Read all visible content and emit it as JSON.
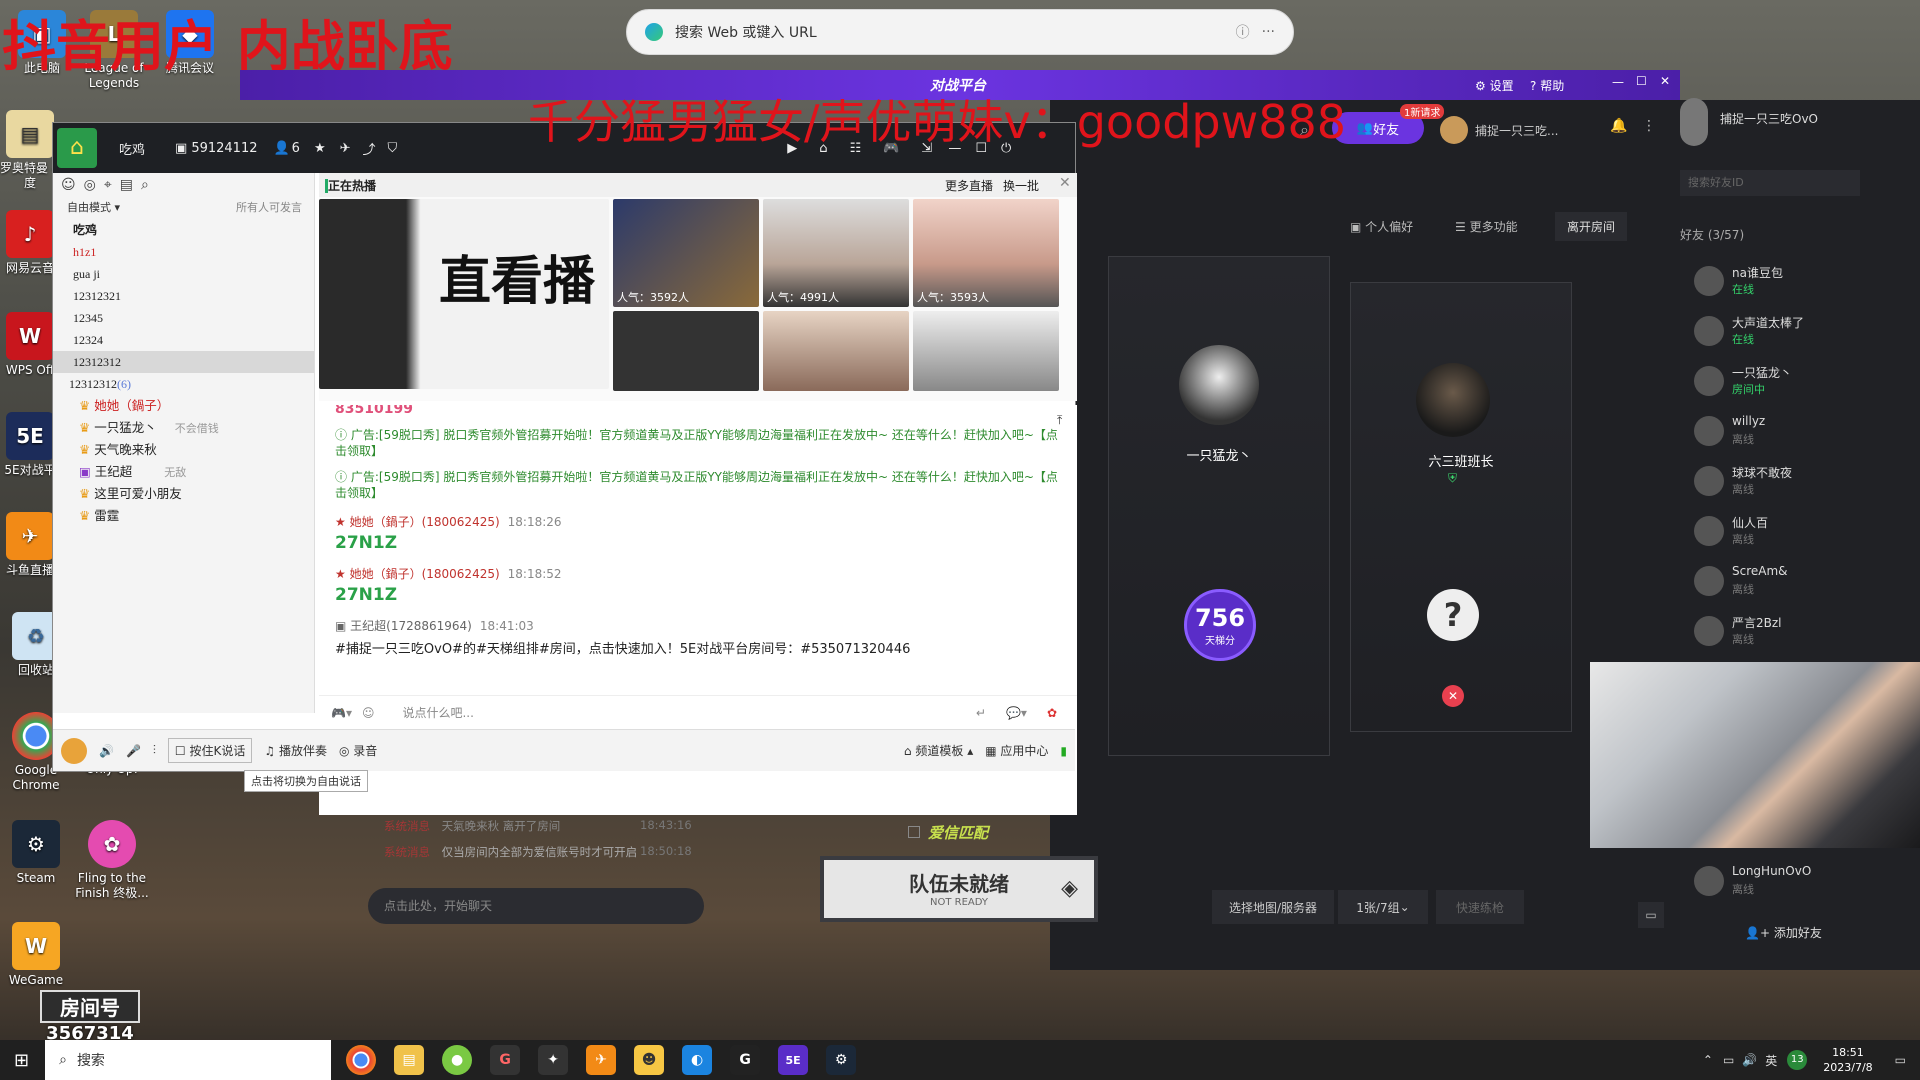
{
  "overlay": {
    "top_left": "抖音用户 内战卧底",
    "center": "千分猛男猛女/声优萌妹v：goodpw888"
  },
  "desktop": {
    "icons": [
      "此电脑",
      "League of Legends",
      "腾讯会议",
      "泰罗奥特曼 - 百度",
      "网易云音",
      "WPS Off",
      "5E对战平",
      "斗鱼直播",
      "回收站",
      "Google Chrome",
      "Only Up!",
      "Steam",
      "Fling to the Finish 终极...",
      "WeGame"
    ],
    "room_label": "房间号",
    "room_number": "3567314"
  },
  "edge": {
    "placeholder": "搜索 Web 或键入 URL"
  },
  "platform": {
    "logo": "对战平台",
    "settings": "设置",
    "help": "帮助",
    "friends_btn": "好友",
    "friend_badge": "1新请求",
    "user_name": "捕捉一只三吃...",
    "side_user": "捕捉一只三吃OvO",
    "search_friend": "搜索好友ID",
    "menu": {
      "preferences": "个人偏好",
      "more": "更多功能",
      "leave": "离开房间"
    },
    "player1": "一只猛龙丶",
    "player2": "六三班班长",
    "score": "756",
    "score_label": "天梯分",
    "love_match": "爱信匹配",
    "ready_main": "队伍未就绪",
    "ready_sub": "NOT READY",
    "map_select": "选择地图/服务器",
    "mode": "1张/7组",
    "quick": "快速练枪",
    "chat_placeholder": "点击此处，开始聊天",
    "sys": [
      {
        "tag": "系统消息",
        "text": "天氣晚来秋 离开了房间",
        "time": "18:43:16"
      },
      {
        "tag": "系统消息",
        "text": "仅当房间内全部为爱信账号时才可开启",
        "time": "18:50:18"
      }
    ],
    "friends_title": "好友 (3/57)",
    "add_friend": "添加好友",
    "friends": [
      {
        "name": "na谁豆包",
        "status": "在线",
        "on": true
      },
      {
        "name": "大声道太棒了",
        "status": "在线",
        "on": true
      },
      {
        "name": "一只猛龙丶",
        "status": "房间中",
        "on": true
      },
      {
        "name": "willyz",
        "status": "离线",
        "on": false
      },
      {
        "name": "球球不敢夜",
        "status": "离线",
        "on": false
      },
      {
        "name": "仙人百",
        "status": "离线",
        "on": false
      },
      {
        "name": "ScreAm&",
        "status": "离线",
        "on": false
      },
      {
        "name": "严言2Bzl",
        "status": "离线",
        "on": false
      },
      {
        "name": "LongHunOvO",
        "status": "离线",
        "on": false
      }
    ]
  },
  "yy": {
    "channel": "吃鸡",
    "id": "59124112",
    "members": "6",
    "mode": "自由模式",
    "speak_rule": "所有人可发言",
    "tree": [
      "吃鸡",
      "h1z1",
      "gua ji",
      "12312321",
      "12345",
      "12324",
      "12312312",
      "12312312"
    ],
    "tree_count": "(6)",
    "members_list": [
      {
        "name": "她她（鍋子）",
        "note": ""
      },
      {
        "name": "一只猛龙丶",
        "note": "不会借钱"
      },
      {
        "name": "天气晚来秋",
        "note": ""
      },
      {
        "name": "王纪超",
        "note": "无敌"
      },
      {
        "name": "这里可爱小朋友",
        "note": ""
      },
      {
        "name": "雷霆",
        "note": ""
      }
    ],
    "hot_title": "正在热播",
    "more_live": "更多直播",
    "refresh": "换一批",
    "live_banner": "直看播",
    "pop": [
      "人气：3592人",
      "人气：4991人",
      "人气：3593人"
    ],
    "chat_id": "83510199",
    "ad": "广告:[59脱口秀] 脱口秀官频外管招募开始啦！官方频道黄马及正版YY能够周边海量福利正在发放中~ 还在等什么！赶快加入吧~【点击领取】",
    "msgs": [
      {
        "user": "她她（鍋子）(180062425)",
        "time": "18:18:26",
        "body": "27N1Z"
      },
      {
        "user": "她她（鍋子）(180062425)",
        "time": "18:18:52",
        "body": "27N1Z"
      }
    ],
    "last_user": "王纪超(1728861964)",
    "last_time": "18:41:03",
    "last_body": "#捕捉一只三吃OvO#的#天梯组排#房间，点击快速加入！5E对战平台房间号：#535071320446",
    "input_placeholder": "说点什么吧...",
    "bottom": {
      "ptt": "按住K说话",
      "music": "播放伴奏",
      "record": "录音",
      "template": "频道模板",
      "apps": "应用中心",
      "tooltip": "点击将切换为自由说话"
    }
  },
  "taskbar": {
    "search": "搜索",
    "lang": "英",
    "badge": "13",
    "time": "18:51",
    "date": "2023/7/8"
  }
}
